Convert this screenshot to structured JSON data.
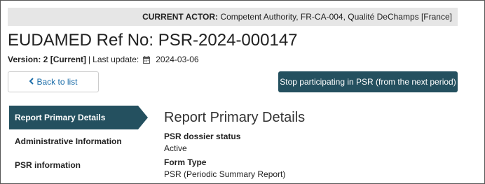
{
  "actor": {
    "label": "CURRENT ACTOR:",
    "value": "Competent Authority, FR-CA-004, Qualité DeChamps [France]"
  },
  "page": {
    "title": "EUDAMED Ref No: PSR-2024-000147",
    "version": "Version: 2 [Current]",
    "separator": "|",
    "last_update_label": "Last update:",
    "last_update_date": "2024-03-06"
  },
  "actions": {
    "back_label": "Back to list",
    "stop_label": "Stop participating in PSR (from the next period)"
  },
  "sidebar": {
    "items": [
      {
        "label": "Report Primary Details",
        "active": true
      },
      {
        "label": "Administrative Information",
        "active": false
      },
      {
        "label": "PSR information",
        "active": false
      }
    ]
  },
  "section": {
    "title": "Report Primary Details",
    "fields": [
      {
        "label": "PSR dossier status",
        "value": "Active"
      },
      {
        "label": "Form Type",
        "value": "PSR (Periodic Summary Report)"
      }
    ]
  },
  "colors": {
    "accent": "#24505f",
    "link": "#1a6ca8",
    "actor_bar_bg": "#e6e6e6"
  },
  "icons": {
    "back": "chevron-left-icon",
    "date": "calendar-icon"
  }
}
